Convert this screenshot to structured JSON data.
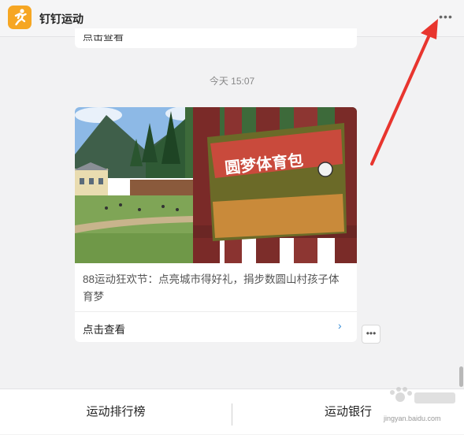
{
  "header": {
    "title": "钉钉运动",
    "icon": "running-person-icon",
    "more_icon": "more-dots-icon",
    "accent": "#f6a623"
  },
  "chat": {
    "previous_card_text": "点击查看",
    "timestamp": "今天 15:07",
    "card": {
      "image_caption": "圆梦体育包",
      "description": "88运动狂欢节：点亮城市得好礼，捐步数圆山村孩子体育梦",
      "action_label": "点击查看",
      "action_chevron": "›",
      "more_icon": "more-dots-icon"
    }
  },
  "bottom_bar": {
    "left_label": "运动排行榜",
    "right_label": "运动银行"
  },
  "watermark": {
    "text": "jingyan.baidu.com"
  },
  "colors": {
    "background": "#f2f2f3",
    "annotation_arrow": "#e8352e",
    "link": "#3a8fd8"
  }
}
